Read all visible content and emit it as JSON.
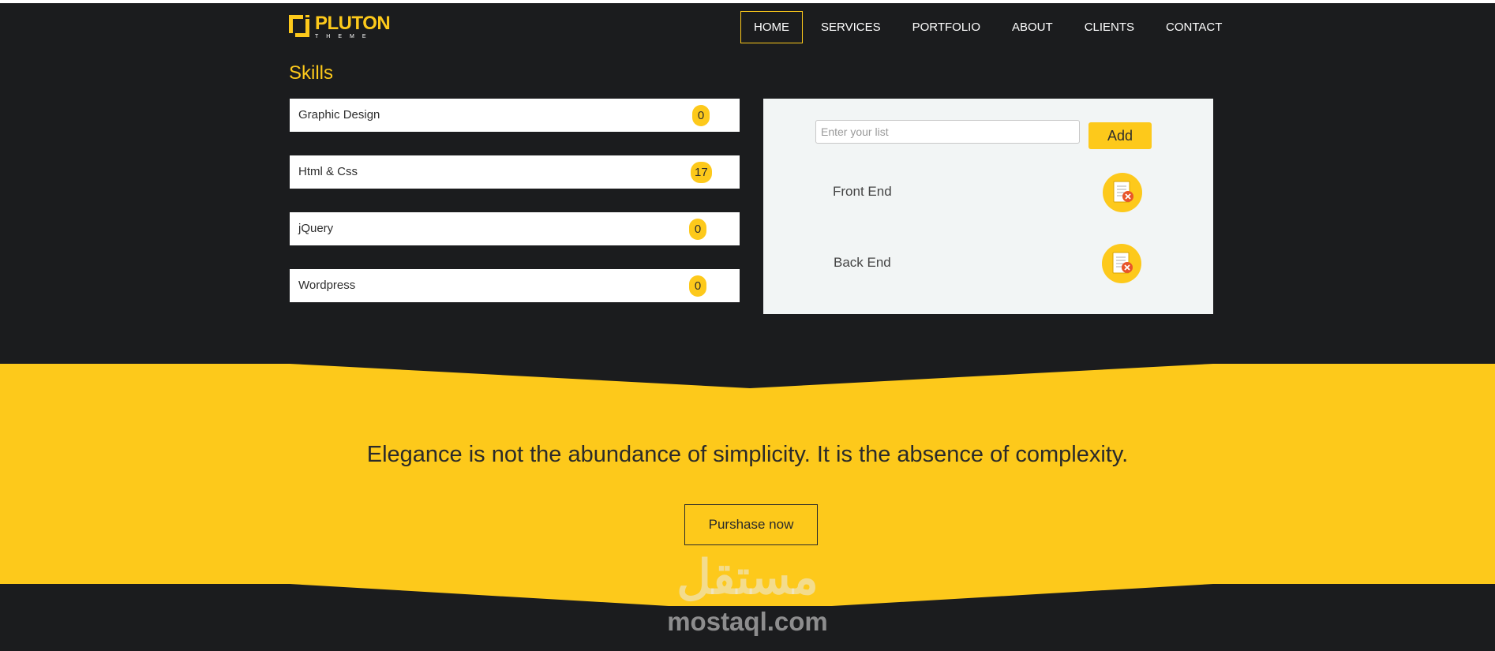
{
  "header": {
    "logo_main": "PLUTON",
    "logo_sub": "THEME",
    "nav": [
      {
        "label": "HOME",
        "active": true
      },
      {
        "label": "SERVICES",
        "active": false
      },
      {
        "label": "PORTFOLIO",
        "active": false
      },
      {
        "label": "ABOUT",
        "active": false
      },
      {
        "label": "CLIENTS",
        "active": false
      },
      {
        "label": "CONTACT",
        "active": false
      }
    ]
  },
  "skills": {
    "title": "Skills",
    "items": [
      {
        "label": "Graphic Design",
        "count": "0"
      },
      {
        "label": "Html & Css",
        "count": "17"
      },
      {
        "label": "jQuery",
        "count": "0"
      },
      {
        "label": "Wordpress",
        "count": "0"
      }
    ]
  },
  "list_panel": {
    "input_placeholder": "Enter your list",
    "input_value": "",
    "add_label": "Add",
    "items": [
      {
        "label": "Front End",
        "icon": "delete-document-icon"
      },
      {
        "label": "Back End",
        "icon": "delete-document-icon"
      }
    ]
  },
  "banner": {
    "quote": "Elegance is not the abundance of simplicity. It is the absence of complexity.",
    "button_label": "Purshase now"
  },
  "watermark": {
    "arabic": "مستقل",
    "latin": "mostaql.com"
  },
  "colors": {
    "accent": "#fdc91b",
    "dark_bg": "#1b1c1e",
    "panel_bg": "#f2f5f5",
    "icon_red": "#e8552a"
  }
}
